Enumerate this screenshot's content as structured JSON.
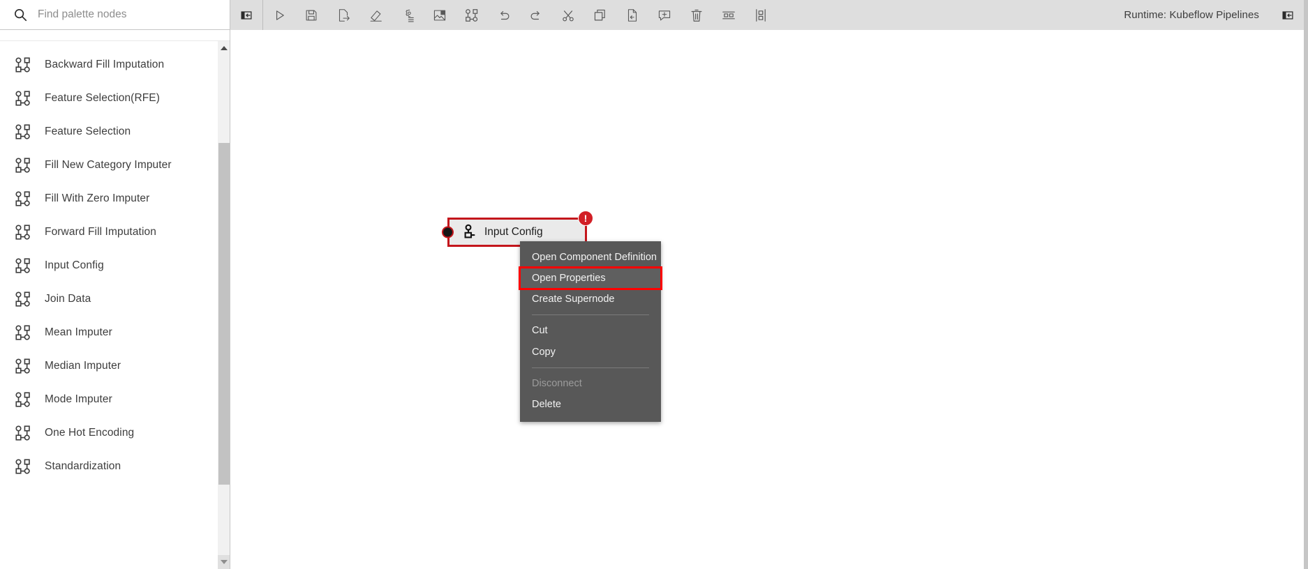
{
  "palette": {
    "search": {
      "placeholder": "Find palette nodes",
      "value": "",
      "icon": "search-icon"
    },
    "scrollbar": {
      "up_icon": "arrow-up-icon",
      "down_icon": "arrow-down-icon"
    },
    "item_icon": "node-graph-icon",
    "items": [
      {
        "label": "Backward Fill Imputation"
      },
      {
        "label": "Feature Selection(RFE)"
      },
      {
        "label": "Feature Selection"
      },
      {
        "label": "Fill New Category Imputer"
      },
      {
        "label": "Fill With Zero Imputer"
      },
      {
        "label": "Forward Fill Imputation"
      },
      {
        "label": "Input Config"
      },
      {
        "label": "Join Data"
      },
      {
        "label": "Mean Imputer"
      },
      {
        "label": "Median Imputer"
      },
      {
        "label": "Mode Imputer"
      },
      {
        "label": "One Hot Encoding"
      },
      {
        "label": "Standardization"
      }
    ]
  },
  "toolbar": {
    "runtime_label": "Runtime: Kubeflow Pipelines",
    "buttons": [
      {
        "name": "toggle-left-panel-button",
        "icon": "panel-collapse-left-icon",
        "title": "Open panel"
      },
      {
        "name": "run-pipeline-button",
        "icon": "play-icon",
        "title": "Run Pipeline"
      },
      {
        "name": "save-pipeline-button",
        "icon": "save-icon",
        "title": "Save Pipeline"
      },
      {
        "name": "export-pipeline-button",
        "icon": "export-icon",
        "title": "Export Pipeline"
      },
      {
        "name": "clear-pipeline-button",
        "icon": "eraser-icon",
        "title": "Clear Pipeline"
      },
      {
        "name": "pipeline-properties-button",
        "icon": "gear-list-icon",
        "title": "Open Pipeline Properties"
      },
      {
        "name": "add-comment-button",
        "icon": "image-panel-icon",
        "title": "Add Comment"
      },
      {
        "name": "create-supernode-button",
        "icon": "nodes-icon",
        "title": "Create Supernode"
      },
      {
        "name": "undo-button",
        "icon": "undo-icon",
        "title": "Undo"
      },
      {
        "name": "redo-button",
        "icon": "redo-icon",
        "title": "Redo"
      },
      {
        "name": "cut-button",
        "icon": "scissors-icon",
        "title": "Cut"
      },
      {
        "name": "copy-button",
        "icon": "copy-icon",
        "title": "Copy"
      },
      {
        "name": "paste-button",
        "icon": "paste-icon",
        "title": "Paste"
      },
      {
        "name": "comment-button",
        "icon": "comment-plus-icon",
        "title": "Add Comment"
      },
      {
        "name": "delete-button",
        "icon": "trash-icon",
        "title": "Delete"
      },
      {
        "name": "arrange-horizontal-button",
        "icon": "arrange-horizontal-icon",
        "title": "Arrange Horizontally"
      },
      {
        "name": "arrange-vertical-button",
        "icon": "arrange-vertical-icon",
        "title": "Arrange Vertically"
      }
    ],
    "right_button": {
      "name": "toggle-right-panel-button",
      "icon": "panel-collapse-right-icon"
    }
  },
  "canvas": {
    "node": {
      "label": "Input Config",
      "icon": "node-component-icon",
      "error_badge": "!",
      "input_port": "input-port"
    }
  },
  "context_menu": {
    "items": [
      {
        "label": "Open Component Definition",
        "state": "enabled",
        "separator_after": false
      },
      {
        "label": "Open Properties",
        "state": "highlighted",
        "separator_after": false
      },
      {
        "label": "Create Supernode",
        "state": "enabled",
        "separator_after": true
      },
      {
        "label": "Cut",
        "state": "enabled",
        "separator_after": false
      },
      {
        "label": "Copy",
        "state": "enabled",
        "separator_after": true
      },
      {
        "label": "Disconnect",
        "state": "disabled",
        "separator_after": false
      },
      {
        "label": "Delete",
        "state": "enabled",
        "separator_after": false
      }
    ]
  },
  "colors": {
    "accent_red": "#c4161c",
    "highlight_red": "#ff0000",
    "toolbar_bg": "#dedede",
    "menu_bg": "#585858",
    "node_bg": "#eaeaea"
  }
}
